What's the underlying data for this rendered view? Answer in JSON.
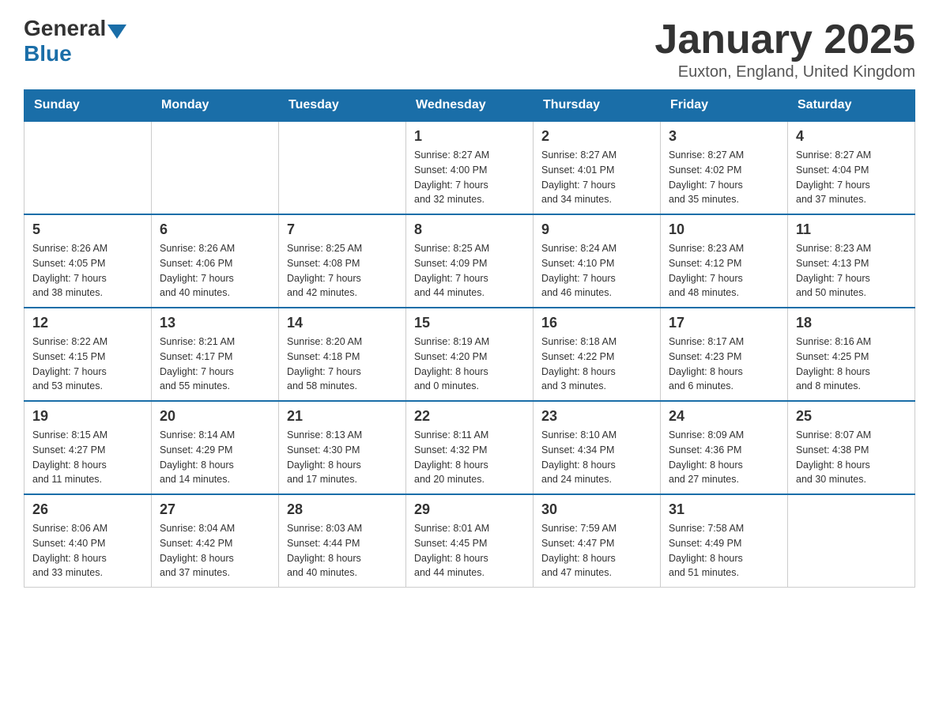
{
  "logo": {
    "general": "General",
    "blue": "Blue"
  },
  "title": {
    "month_year": "January 2025",
    "location": "Euxton, England, United Kingdom"
  },
  "weekdays": [
    "Sunday",
    "Monday",
    "Tuesday",
    "Wednesday",
    "Thursday",
    "Friday",
    "Saturday"
  ],
  "weeks": [
    [
      {
        "day": "",
        "info": ""
      },
      {
        "day": "",
        "info": ""
      },
      {
        "day": "",
        "info": ""
      },
      {
        "day": "1",
        "info": "Sunrise: 8:27 AM\nSunset: 4:00 PM\nDaylight: 7 hours\nand 32 minutes."
      },
      {
        "day": "2",
        "info": "Sunrise: 8:27 AM\nSunset: 4:01 PM\nDaylight: 7 hours\nand 34 minutes."
      },
      {
        "day": "3",
        "info": "Sunrise: 8:27 AM\nSunset: 4:02 PM\nDaylight: 7 hours\nand 35 minutes."
      },
      {
        "day": "4",
        "info": "Sunrise: 8:27 AM\nSunset: 4:04 PM\nDaylight: 7 hours\nand 37 minutes."
      }
    ],
    [
      {
        "day": "5",
        "info": "Sunrise: 8:26 AM\nSunset: 4:05 PM\nDaylight: 7 hours\nand 38 minutes."
      },
      {
        "day": "6",
        "info": "Sunrise: 8:26 AM\nSunset: 4:06 PM\nDaylight: 7 hours\nand 40 minutes."
      },
      {
        "day": "7",
        "info": "Sunrise: 8:25 AM\nSunset: 4:08 PM\nDaylight: 7 hours\nand 42 minutes."
      },
      {
        "day": "8",
        "info": "Sunrise: 8:25 AM\nSunset: 4:09 PM\nDaylight: 7 hours\nand 44 minutes."
      },
      {
        "day": "9",
        "info": "Sunrise: 8:24 AM\nSunset: 4:10 PM\nDaylight: 7 hours\nand 46 minutes."
      },
      {
        "day": "10",
        "info": "Sunrise: 8:23 AM\nSunset: 4:12 PM\nDaylight: 7 hours\nand 48 minutes."
      },
      {
        "day": "11",
        "info": "Sunrise: 8:23 AM\nSunset: 4:13 PM\nDaylight: 7 hours\nand 50 minutes."
      }
    ],
    [
      {
        "day": "12",
        "info": "Sunrise: 8:22 AM\nSunset: 4:15 PM\nDaylight: 7 hours\nand 53 minutes."
      },
      {
        "day": "13",
        "info": "Sunrise: 8:21 AM\nSunset: 4:17 PM\nDaylight: 7 hours\nand 55 minutes."
      },
      {
        "day": "14",
        "info": "Sunrise: 8:20 AM\nSunset: 4:18 PM\nDaylight: 7 hours\nand 58 minutes."
      },
      {
        "day": "15",
        "info": "Sunrise: 8:19 AM\nSunset: 4:20 PM\nDaylight: 8 hours\nand 0 minutes."
      },
      {
        "day": "16",
        "info": "Sunrise: 8:18 AM\nSunset: 4:22 PM\nDaylight: 8 hours\nand 3 minutes."
      },
      {
        "day": "17",
        "info": "Sunrise: 8:17 AM\nSunset: 4:23 PM\nDaylight: 8 hours\nand 6 minutes."
      },
      {
        "day": "18",
        "info": "Sunrise: 8:16 AM\nSunset: 4:25 PM\nDaylight: 8 hours\nand 8 minutes."
      }
    ],
    [
      {
        "day": "19",
        "info": "Sunrise: 8:15 AM\nSunset: 4:27 PM\nDaylight: 8 hours\nand 11 minutes."
      },
      {
        "day": "20",
        "info": "Sunrise: 8:14 AM\nSunset: 4:29 PM\nDaylight: 8 hours\nand 14 minutes."
      },
      {
        "day": "21",
        "info": "Sunrise: 8:13 AM\nSunset: 4:30 PM\nDaylight: 8 hours\nand 17 minutes."
      },
      {
        "day": "22",
        "info": "Sunrise: 8:11 AM\nSunset: 4:32 PM\nDaylight: 8 hours\nand 20 minutes."
      },
      {
        "day": "23",
        "info": "Sunrise: 8:10 AM\nSunset: 4:34 PM\nDaylight: 8 hours\nand 24 minutes."
      },
      {
        "day": "24",
        "info": "Sunrise: 8:09 AM\nSunset: 4:36 PM\nDaylight: 8 hours\nand 27 minutes."
      },
      {
        "day": "25",
        "info": "Sunrise: 8:07 AM\nSunset: 4:38 PM\nDaylight: 8 hours\nand 30 minutes."
      }
    ],
    [
      {
        "day": "26",
        "info": "Sunrise: 8:06 AM\nSunset: 4:40 PM\nDaylight: 8 hours\nand 33 minutes."
      },
      {
        "day": "27",
        "info": "Sunrise: 8:04 AM\nSunset: 4:42 PM\nDaylight: 8 hours\nand 37 minutes."
      },
      {
        "day": "28",
        "info": "Sunrise: 8:03 AM\nSunset: 4:44 PM\nDaylight: 8 hours\nand 40 minutes."
      },
      {
        "day": "29",
        "info": "Sunrise: 8:01 AM\nSunset: 4:45 PM\nDaylight: 8 hours\nand 44 minutes."
      },
      {
        "day": "30",
        "info": "Sunrise: 7:59 AM\nSunset: 4:47 PM\nDaylight: 8 hours\nand 47 minutes."
      },
      {
        "day": "31",
        "info": "Sunrise: 7:58 AM\nSunset: 4:49 PM\nDaylight: 8 hours\nand 51 minutes."
      },
      {
        "day": "",
        "info": ""
      }
    ]
  ]
}
